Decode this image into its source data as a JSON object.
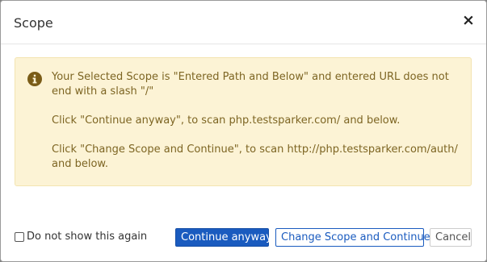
{
  "dialog": {
    "title": "Scope",
    "close_glyph": "×"
  },
  "alert": {
    "icon": "info-icon",
    "lines": [
      "Your Selected Scope is \"Entered Path and Below\" and entered URL does not end with a slash \"/\"",
      "Click \"Continue anyway\", to scan php.testsparker.com/ and below.",
      "Click \"Change Scope and Continue\", to scan http://php.testsparker.com/auth/ and below."
    ],
    "colors": {
      "background": "#fcf3d5",
      "text": "#7d6523",
      "icon": "#7a5c17"
    }
  },
  "footer": {
    "checkbox_label": "Do not show this again",
    "checkbox_checked": false,
    "continue_label": "Continue anyway",
    "change_scope_label": "Change Scope and Continue",
    "cancel_label": "Cancel"
  },
  "colors": {
    "primary": "#1a5bbf"
  }
}
